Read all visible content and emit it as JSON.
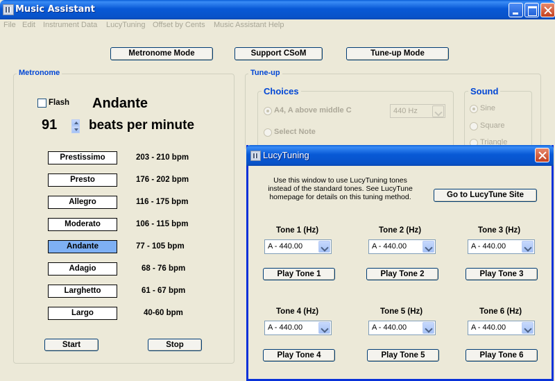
{
  "window": {
    "title": "Music Assistant"
  },
  "menu": [
    "File",
    "Edit",
    "Instrument Data",
    "LucyTuning",
    "Offset by Cents",
    "Music Assistant Help"
  ],
  "modes": {
    "metronome": "Metronome Mode",
    "support": "Support CSoM",
    "tuneup": "Tune-up Mode"
  },
  "metronome": {
    "group_label": "Metronome",
    "flash_label": "Flash",
    "flash_checked": false,
    "current_tempo": "Andante",
    "bpm_value": "91",
    "bpm_unit": "beats per minute",
    "tempos": [
      {
        "name": "Prestissimo",
        "range": "203 - 210 bpm"
      },
      {
        "name": "Presto",
        "range": "176 - 202 bpm"
      },
      {
        "name": "Allegro",
        "range": "116 - 175 bpm"
      },
      {
        "name": "Moderato",
        "range": "106 - 115 bpm"
      },
      {
        "name": "Andante",
        "range": "77 - 105 bpm",
        "active": true
      },
      {
        "name": "Adagio",
        "range": "68 - 76 bpm"
      },
      {
        "name": "Larghetto",
        "range": "61 - 67 bpm"
      },
      {
        "name": "Largo",
        "range": "40-60 bpm"
      }
    ],
    "start_label": "Start",
    "stop_label": "Stop"
  },
  "tuneup": {
    "group_label": "Tune-up",
    "choices_label": "Choices",
    "choice_a4": "A4, A above middle C",
    "choice_select": "Select Note",
    "freq_value": "440 Hz",
    "sound_label": "Sound",
    "sounds": [
      "Sine",
      "Square",
      "Triangle"
    ]
  },
  "lucy": {
    "title": "LucyTuning",
    "description": "Use this window to use LucyTuning tones instead of the standard tones.  See LucyTune homepage for details on this tuning method.",
    "site_button": "Go to LucyTune Site",
    "tones": [
      {
        "label": "Tone 1 (Hz)",
        "value": "A  - 440.00",
        "play": "Play Tone 1"
      },
      {
        "label": "Tone 2 (Hz)",
        "value": "A  - 440.00",
        "play": "Play Tone 2"
      },
      {
        "label": "Tone 3 (Hz)",
        "value": "A  - 440.00",
        "play": "Play Tone 3"
      },
      {
        "label": "Tone 4 (Hz)",
        "value": "A  - 440.00",
        "play": "Play Tone 4"
      },
      {
        "label": "Tone 5 (Hz)",
        "value": "A  - 440.00",
        "play": "Play Tone 5"
      },
      {
        "label": "Tone 6 (Hz)",
        "value": "A  - 440.00",
        "play": "Play Tone 6"
      }
    ]
  },
  "colors": {
    "titlebar": "#0859d6",
    "group_label": "#0046d5",
    "face": "#ece9d8",
    "active_tempo": "#7eb0f4"
  }
}
